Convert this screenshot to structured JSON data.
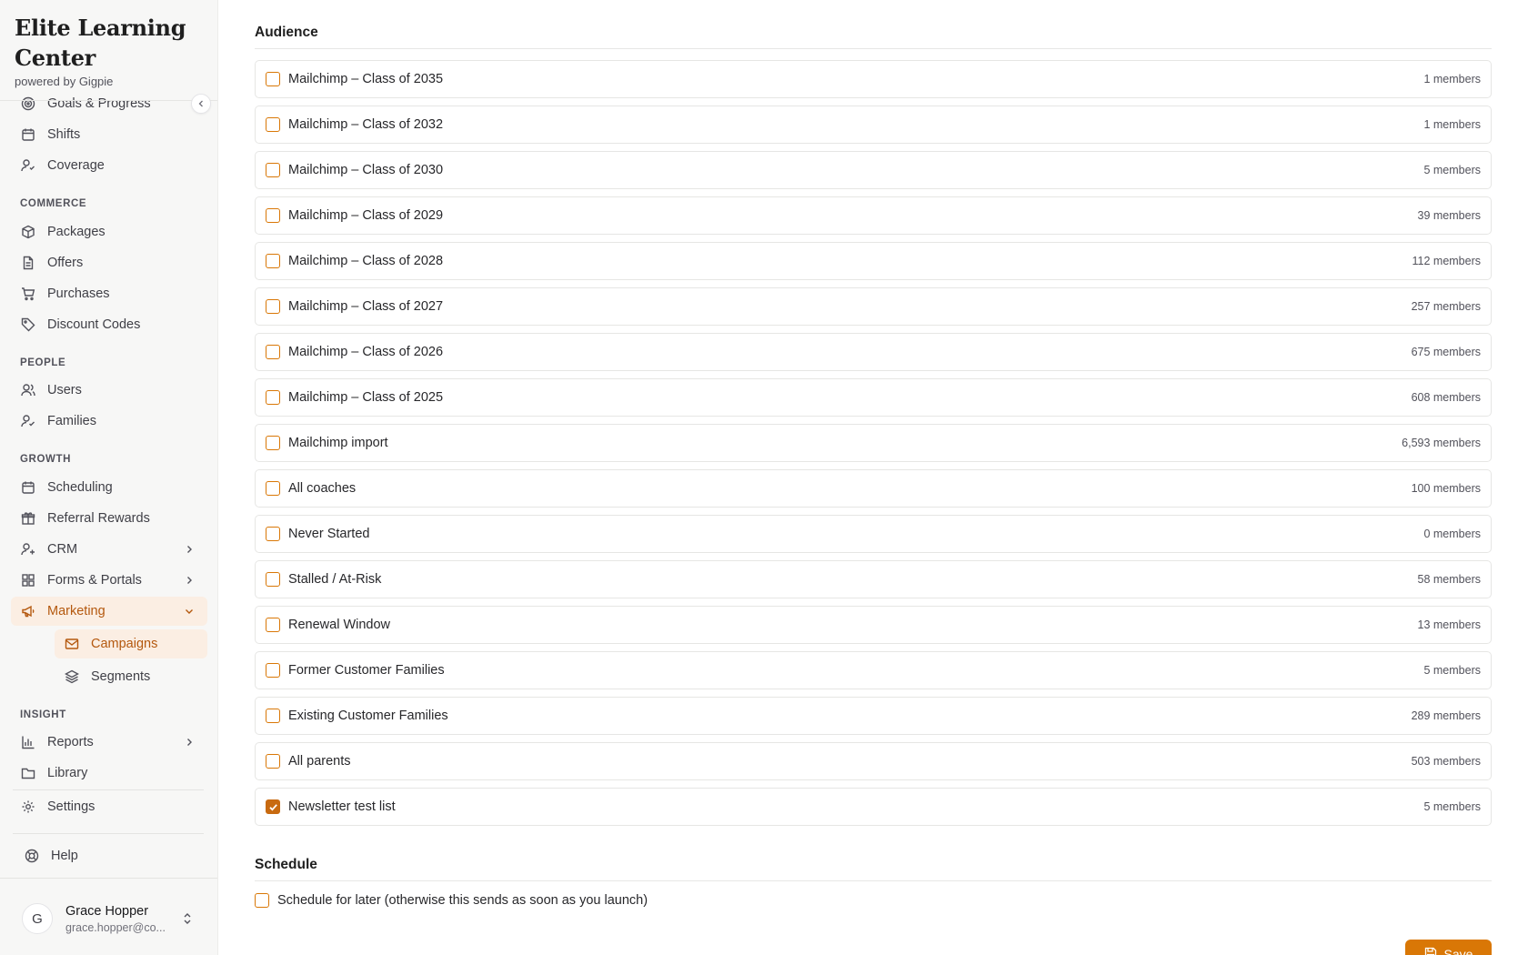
{
  "brand": {
    "name": "Elite Learning Center",
    "powered_by": "powered by Gigpie"
  },
  "sidebar": {
    "top_items": [
      {
        "label": "Goals & Progress",
        "icon": "target-icon"
      },
      {
        "label": "Shifts",
        "icon": "calendar-icon"
      },
      {
        "label": "Coverage",
        "icon": "user-icon"
      }
    ],
    "sections": {
      "commerce": "COMMERCE",
      "people": "PEOPLE",
      "growth": "GROWTH",
      "insight": "INSIGHT"
    },
    "commerce_items": [
      {
        "label": "Packages",
        "icon": "box-icon"
      },
      {
        "label": "Offers",
        "icon": "document-icon"
      },
      {
        "label": "Purchases",
        "icon": "cart-icon"
      },
      {
        "label": "Discount Codes",
        "icon": "tag-icon"
      }
    ],
    "people_items": [
      {
        "label": "Users",
        "icon": "users-icon"
      },
      {
        "label": "Families",
        "icon": "user-check-icon"
      }
    ],
    "growth_items": [
      {
        "label": "Scheduling",
        "icon": "calendar-icon"
      },
      {
        "label": "Referral Rewards",
        "icon": "gift-icon"
      },
      {
        "label": "CRM",
        "icon": "user-plus-icon"
      },
      {
        "label": "Forms & Portals",
        "icon": "grid-icon"
      },
      {
        "label": "Marketing",
        "icon": "megaphone-icon"
      }
    ],
    "marketing_sub": [
      {
        "label": "Campaigns",
        "icon": "mail-icon"
      },
      {
        "label": "Segments",
        "icon": "layers-icon"
      }
    ],
    "insight_items": [
      {
        "label": "Reports",
        "icon": "bar-chart-icon"
      },
      {
        "label": "Library",
        "icon": "folder-icon"
      }
    ],
    "settings": "Settings",
    "help": "Help"
  },
  "user": {
    "initial": "G",
    "name": "Grace Hopper",
    "email": "grace.hopper@co..."
  },
  "audience": {
    "title": "Audience",
    "rows": [
      {
        "name": "Mailchimp – Class of 2035",
        "count": "1 members",
        "checked": false
      },
      {
        "name": "Mailchimp – Class of 2032",
        "count": "1 members",
        "checked": false
      },
      {
        "name": "Mailchimp – Class of 2030",
        "count": "5 members",
        "checked": false
      },
      {
        "name": "Mailchimp – Class of 2029",
        "count": "39 members",
        "checked": false
      },
      {
        "name": "Mailchimp – Class of 2028",
        "count": "112 members",
        "checked": false
      },
      {
        "name": "Mailchimp – Class of 2027",
        "count": "257 members",
        "checked": false
      },
      {
        "name": "Mailchimp – Class of 2026",
        "count": "675 members",
        "checked": false
      },
      {
        "name": "Mailchimp – Class of 2025",
        "count": "608 members",
        "checked": false
      },
      {
        "name": "Mailchimp import",
        "count": "6,593 members",
        "checked": false
      },
      {
        "name": "All coaches",
        "count": "100 members",
        "checked": false
      },
      {
        "name": "Never Started",
        "count": "0 members",
        "checked": false
      },
      {
        "name": "Stalled / At-Risk",
        "count": "58 members",
        "checked": false
      },
      {
        "name": "Renewal Window",
        "count": "13 members",
        "checked": false
      },
      {
        "name": "Former Customer Families",
        "count": "5 members",
        "checked": false
      },
      {
        "name": "Existing Customer Families",
        "count": "289 members",
        "checked": false
      },
      {
        "name": "All parents",
        "count": "503 members",
        "checked": false
      },
      {
        "name": "Newsletter test list",
        "count": "5 members",
        "checked": true
      }
    ]
  },
  "schedule": {
    "title": "Schedule",
    "later_label": "Schedule for later (otherwise this sends as soon as you launch)",
    "later_checked": false
  },
  "footer": {
    "primary_label": "Save"
  },
  "colors": {
    "accent": "#d97706",
    "accent_dark": "#b4580e",
    "active_bg": "#fbeee3"
  }
}
